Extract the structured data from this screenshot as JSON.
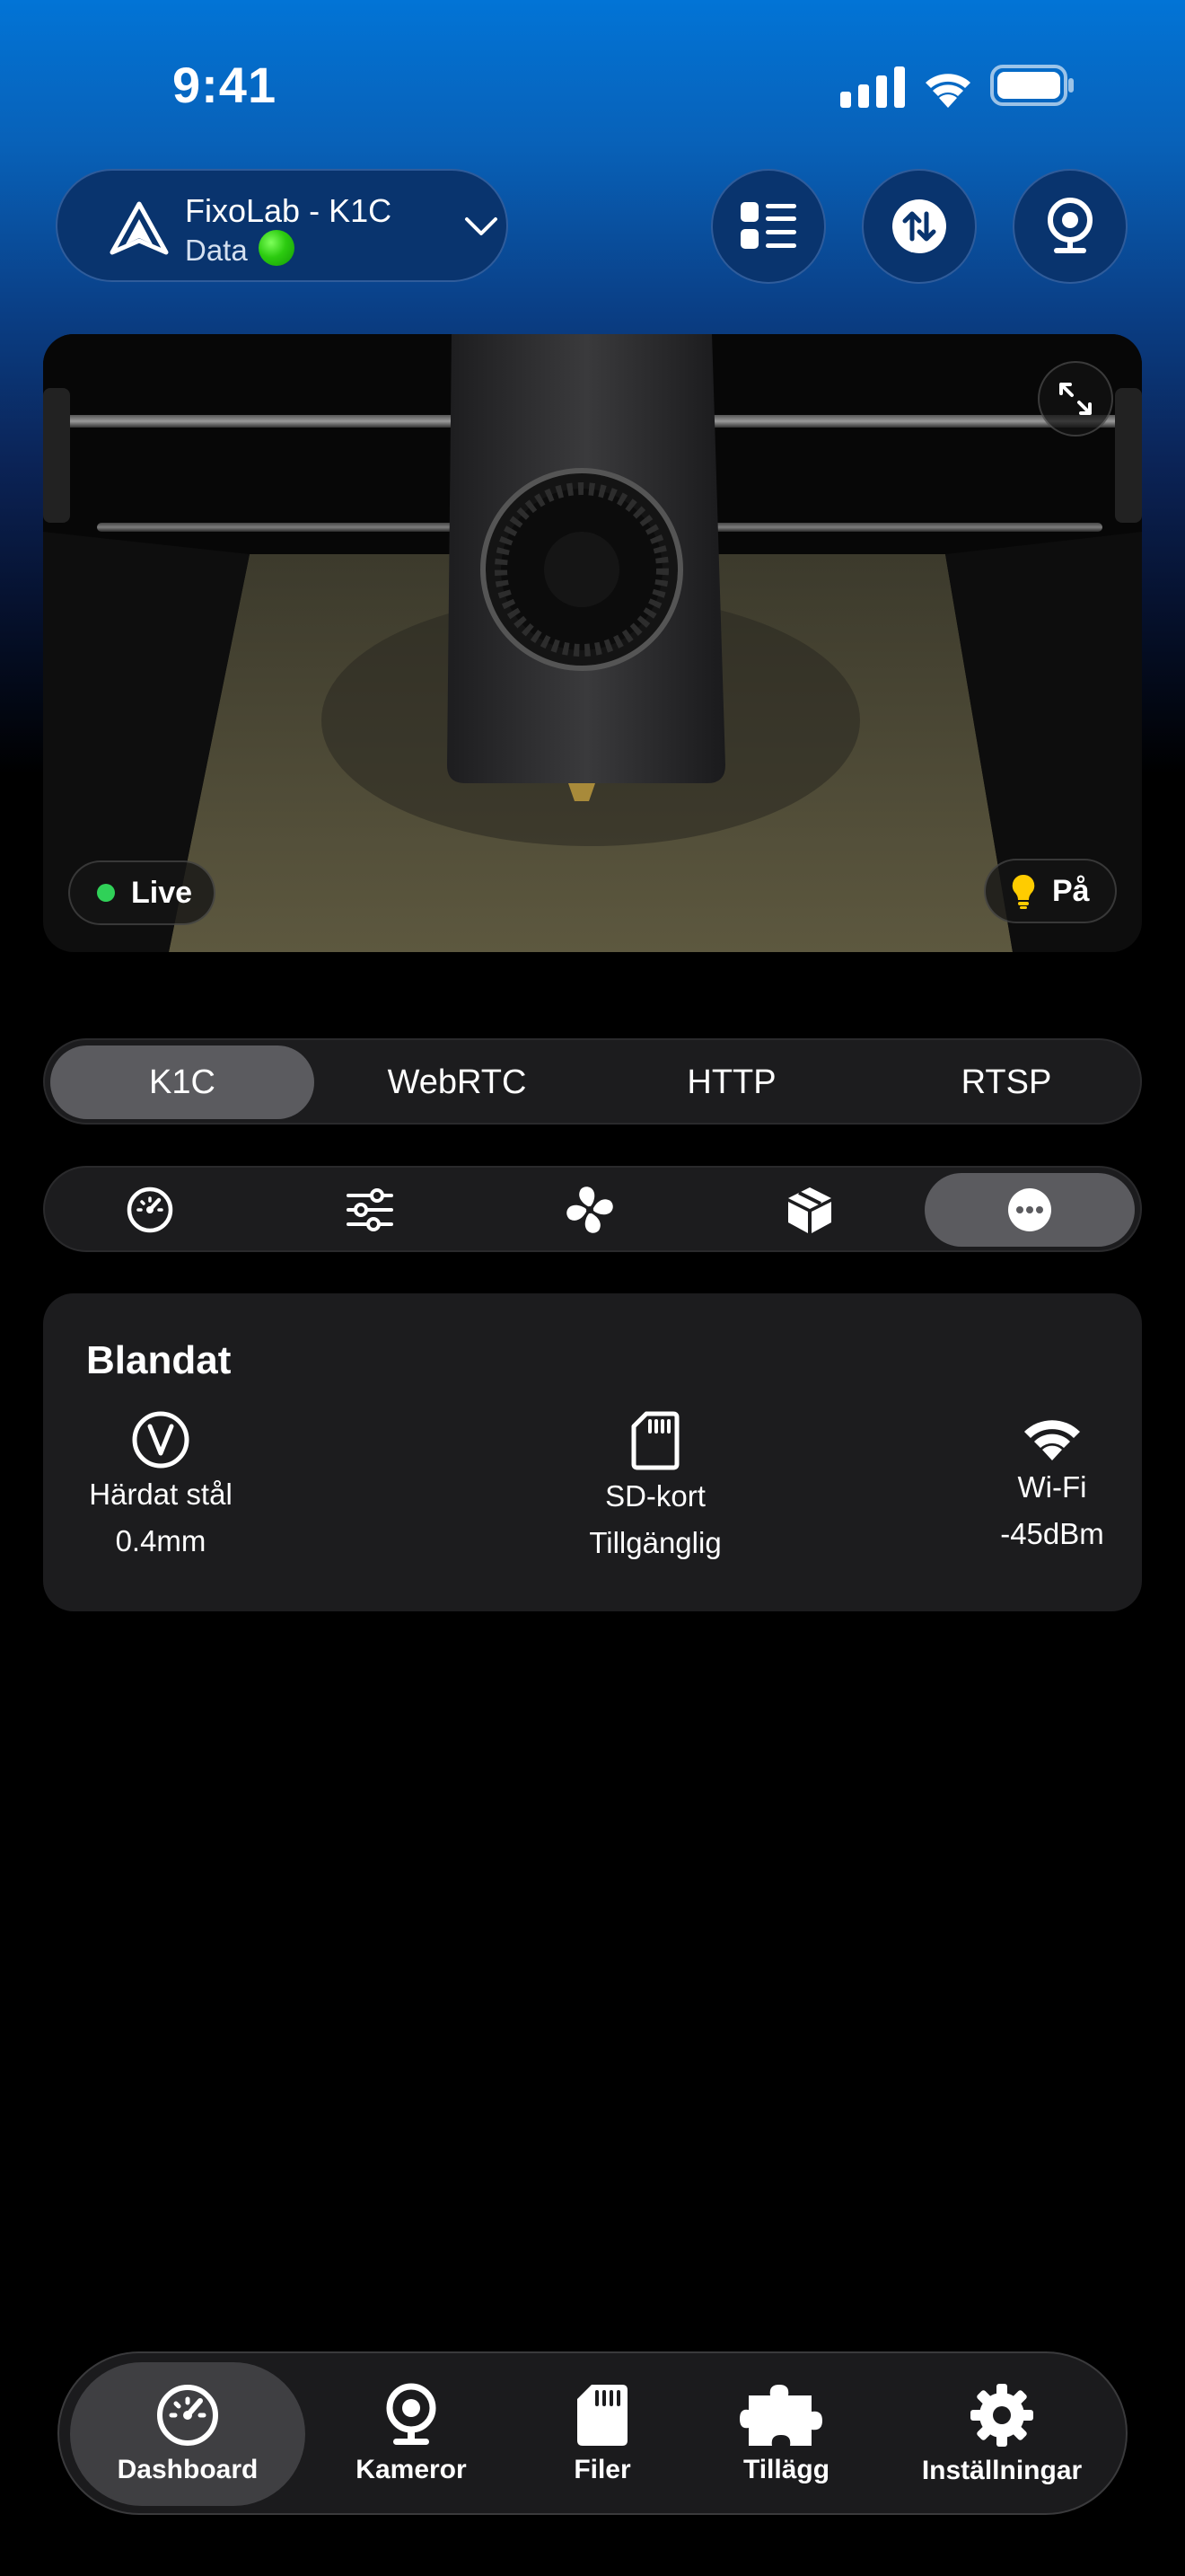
{
  "status_bar": {
    "time": "9:41"
  },
  "header": {
    "printer_name": "FixoLab - K1C",
    "printer_state_label": "Data",
    "icons": [
      "printer-logo-icon",
      "chevron-down-icon",
      "list-icon",
      "transfer-icon",
      "webcam-icon"
    ]
  },
  "camera": {
    "live_label": "Live",
    "light_label": "På",
    "icons": [
      "expand-icon",
      "lightbulb-icon"
    ]
  },
  "stream_tabs": [
    "K1C",
    "WebRTC",
    "HTTP",
    "RTSP"
  ],
  "stream_tab_selected": "K1C",
  "panel_tabs": {
    "icons": [
      "speedometer-icon",
      "sliders-icon",
      "fan-icon",
      "box-icon",
      "more-icon"
    ],
    "selected": "more-icon"
  },
  "card": {
    "title": "Blandat",
    "items": [
      {
        "icon": "nozzle-v-icon",
        "line1": "Härdat stål",
        "line2": "0.4mm"
      },
      {
        "icon": "sd-card-icon",
        "line1": "SD-kort",
        "line2": "Tillgänglig"
      },
      {
        "icon": "wifi-icon",
        "line1": "Wi-Fi",
        "line2": "-45dBm"
      }
    ]
  },
  "nav": {
    "items": [
      {
        "label": "Dashboard",
        "icon": "dashboard-icon"
      },
      {
        "label": "Kameror",
        "icon": "camera-icon"
      },
      {
        "label": "Filer",
        "icon": "file-icon"
      },
      {
        "label": "Tillägg",
        "icon": "puzzle-icon"
      },
      {
        "label": "Inställningar",
        "icon": "gear-icon"
      }
    ],
    "selected": "Dashboard"
  },
  "colors": {
    "accent_blue": "#0274d6",
    "status_green": "#2ccb10",
    "live_dot": "#30d158",
    "bulb_yellow": "#ffcc00",
    "selected_pill": "#5b5b5f"
  }
}
